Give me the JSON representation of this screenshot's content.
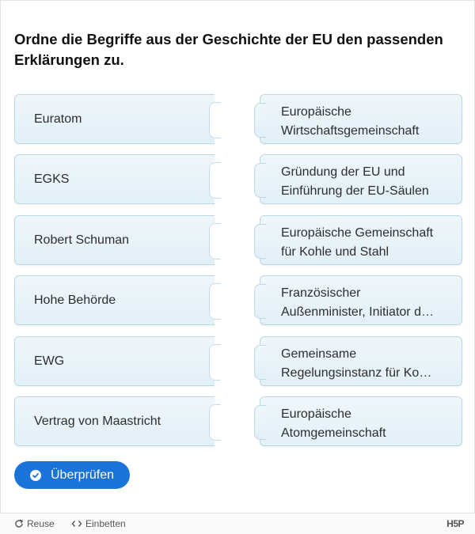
{
  "question": "Ordne die Begriffe aus der Geschichte der EU den passenden Erklärungen zu.",
  "terms": [
    "Euratom",
    "EGKS",
    "Robert Schuman",
    "Hohe Behörde",
    "EWG",
    "Vertrag von Maastricht"
  ],
  "explanations": [
    "Europäische Wirtschaftsgemeinschaft",
    "Gründung der EU und Einführung der EU-Säulen",
    "Europäische Gemeinschaft für Kohle und Stahl",
    "Französischer Außenminister, Initiator d…",
    "Gemeinsame Regelungsinstanz für Ko…",
    "Europäische Atomgemeinschaft"
  ],
  "check_button": {
    "label": "Überprüfen",
    "icon": "check-circle-icon"
  },
  "footer": {
    "reuse": "Reuse",
    "embed": "Einbetten",
    "logo": "H5P"
  },
  "colors": {
    "accent": "#1a73d9",
    "card_bg": "#e8f3f9",
    "card_border": "#bcd7e6"
  }
}
